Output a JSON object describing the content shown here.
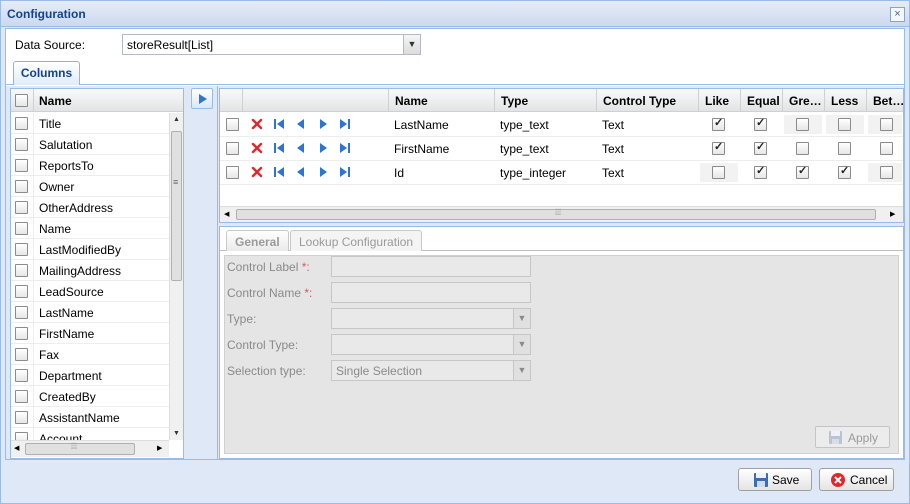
{
  "window": {
    "title": "Configuration",
    "close_symbol": "×"
  },
  "data_source": {
    "label": "Data Source:",
    "value": "storeResult[List]"
  },
  "tabs": {
    "columns": "Columns"
  },
  "left_grid": {
    "header": "Name",
    "items": [
      "Title",
      "Salutation",
      "ReportsTo",
      "Owner",
      "OtherAddress",
      "Name",
      "LastModifiedBy",
      "MailingAddress",
      "LeadSource",
      "LastName",
      "FirstName",
      "Fax",
      "Department",
      "CreatedBy",
      "AssistantName",
      "Account"
    ]
  },
  "right_grid": {
    "headers": [
      "Name",
      "Type",
      "Control Type",
      "Like",
      "Equal",
      "Gre…",
      "Less",
      "Bet…"
    ],
    "rows": [
      {
        "name": "LastName",
        "type": "type_text",
        "control": "Text",
        "like": true,
        "equal": true,
        "greater": false,
        "less": false,
        "between": false
      },
      {
        "name": "FirstName",
        "type": "type_text",
        "control": "Text",
        "like": true,
        "equal": true,
        "greater": false,
        "less": false,
        "between": false
      },
      {
        "name": "Id",
        "type": "type_integer",
        "control": "Text",
        "like": false,
        "equal": true,
        "greater": true,
        "less": true,
        "between": false
      }
    ]
  },
  "detail_tabs": {
    "general": "General",
    "lookup": "Lookup Configuration"
  },
  "form": {
    "control_label": "Control Label",
    "control_name": "Control Name",
    "required_mark": "*:",
    "type": "Type:",
    "control_type": "Control Type:",
    "selection_type": "Selection type:",
    "selection_value": "Single Selection"
  },
  "buttons": {
    "apply": "Apply",
    "save": "Save",
    "cancel": "Cancel"
  },
  "colors": {
    "title": "#15428b",
    "border": "#99bbe8",
    "delete": "#e0282c",
    "nav": "#2d74d6"
  }
}
